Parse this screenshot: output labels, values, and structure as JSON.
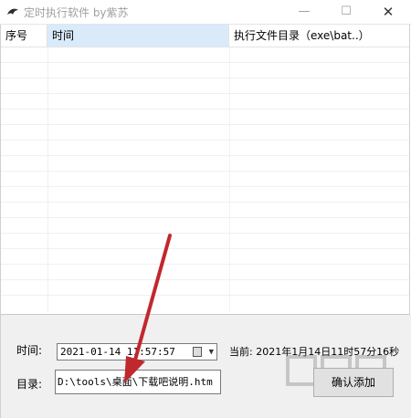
{
  "window": {
    "title": "定时执行软件 by紫苏",
    "minimize_glyph": "—",
    "maximize_glyph": "☐",
    "close_glyph": "✕"
  },
  "table": {
    "columns": [
      "序号",
      "时间",
      "执行文件目录（exe\\bat..）"
    ],
    "rows": []
  },
  "form": {
    "time_label": "时间:",
    "time_value": "2021-01-14 11:57:57",
    "current_label": "当前: 2021年1月14日11时57分16秒",
    "dir_label": "目录:",
    "dir_value": "D:\\tools\\桌面\\下载吧说明.htm",
    "add_button": "确认添加"
  },
  "watermark": "下载吧",
  "colors": {
    "header_selected": "#d9ebfa",
    "panel_bg": "#f0f0f0",
    "arrow": "#c0282d"
  },
  "icons": {
    "app": "dolphin-icon",
    "calendar": "calendar-icon",
    "dropdown": "chevron-down-icon"
  }
}
